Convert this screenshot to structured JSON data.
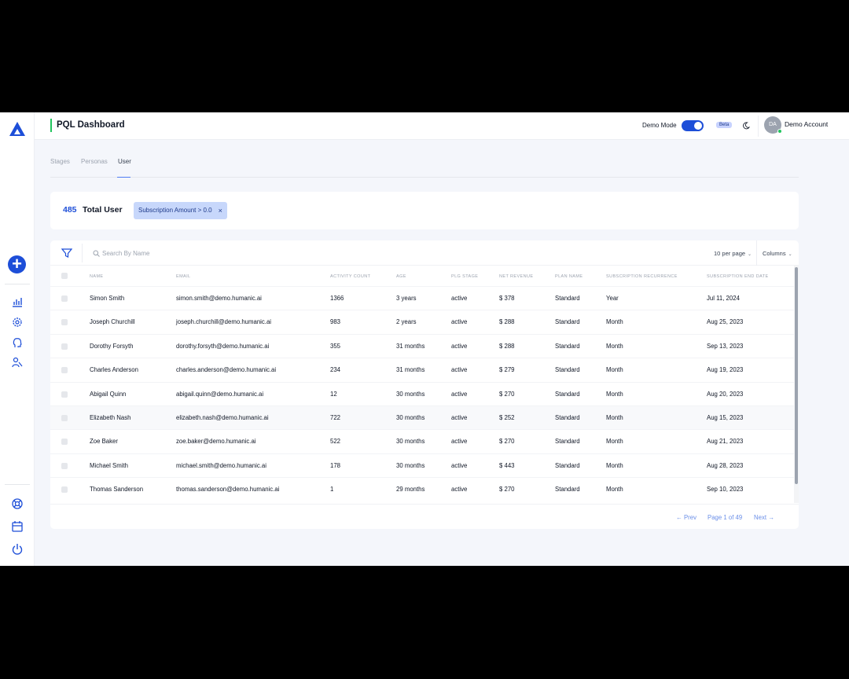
{
  "header": {
    "title": "PQL Dashboard",
    "demo_mode_label": "Demo Mode",
    "demo_mode_on": true,
    "beta_label": "Beta",
    "avatar_initials": "DA",
    "account_name": "Demo Account"
  },
  "sidebar": {
    "logo_icon": "logo-triangle-icon",
    "add_icon": "plus-icon",
    "nav_icons": [
      "chart-icon",
      "gear-icon",
      "head-icon",
      "users-icon"
    ],
    "bottom_icons": [
      "lifebuoy-icon",
      "calendar-icon",
      "power-icon"
    ]
  },
  "tabs": [
    {
      "label": "Stages",
      "active": false
    },
    {
      "label": "Personas",
      "active": false
    },
    {
      "label": "User",
      "active": true
    }
  ],
  "summary": {
    "count": "485",
    "label": "Total User",
    "filter_chip": "Subscription Amount > 0.0",
    "chip_close": "×"
  },
  "toolbar": {
    "search_placeholder": "Search By Name",
    "per_page": "10 per page",
    "columns": "Columns"
  },
  "table": {
    "columns": [
      "Name",
      "Email",
      "Activity Count",
      "Age",
      "PLG Stage",
      "Net Revenue",
      "Plan Name",
      "Subscription Recurrence",
      "Subscription End Date"
    ],
    "rows": [
      [
        "Simon Smith",
        "simon.smith@demo.humanic.ai",
        "1366",
        "3 years",
        "active",
        "$ 378",
        "Standard",
        "Year",
        "Jul 11, 2024"
      ],
      [
        "Joseph Churchill",
        "joseph.churchill@demo.humanic.ai",
        "983",
        "2 years",
        "active",
        "$ 288",
        "Standard",
        "Month",
        "Aug 25, 2023"
      ],
      [
        "Dorothy Forsyth",
        "dorothy.forsyth@demo.humanic.ai",
        "355",
        "31 months",
        "active",
        "$ 288",
        "Standard",
        "Month",
        "Sep 13, 2023"
      ],
      [
        "Charles Anderson",
        "charles.anderson@demo.humanic.ai",
        "234",
        "31 months",
        "active",
        "$ 279",
        "Standard",
        "Month",
        "Aug 19, 2023"
      ],
      [
        "Abigail Quinn",
        "abigail.quinn@demo.humanic.ai",
        "12",
        "30 months",
        "active",
        "$ 270",
        "Standard",
        "Month",
        "Aug 20, 2023"
      ],
      [
        "Elizabeth Nash",
        "elizabeth.nash@demo.humanic.ai",
        "722",
        "30 months",
        "active",
        "$ 252",
        "Standard",
        "Month",
        "Aug 15, 2023"
      ],
      [
        "Zoe Baker",
        "zoe.baker@demo.humanic.ai",
        "522",
        "30 months",
        "active",
        "$ 270",
        "Standard",
        "Month",
        "Aug 21, 2023"
      ],
      [
        "Michael Smith",
        "michael.smith@demo.humanic.ai",
        "178",
        "30 months",
        "active",
        "$ 443",
        "Standard",
        "Month",
        "Aug 28, 2023"
      ],
      [
        "Thomas Sanderson",
        "thomas.sanderson@demo.humanic.ai",
        "1",
        "29 months",
        "active",
        "$ 270",
        "Standard",
        "Month",
        "Sep 10, 2023"
      ]
    ]
  },
  "pagination": {
    "prev": "← Prev",
    "page_info": "Page 1 of 49",
    "next": "Next →"
  },
  "colors": {
    "accent": "#1d4ed8",
    "status_online": "#22c55e",
    "title_bar": "#22c55e"
  }
}
